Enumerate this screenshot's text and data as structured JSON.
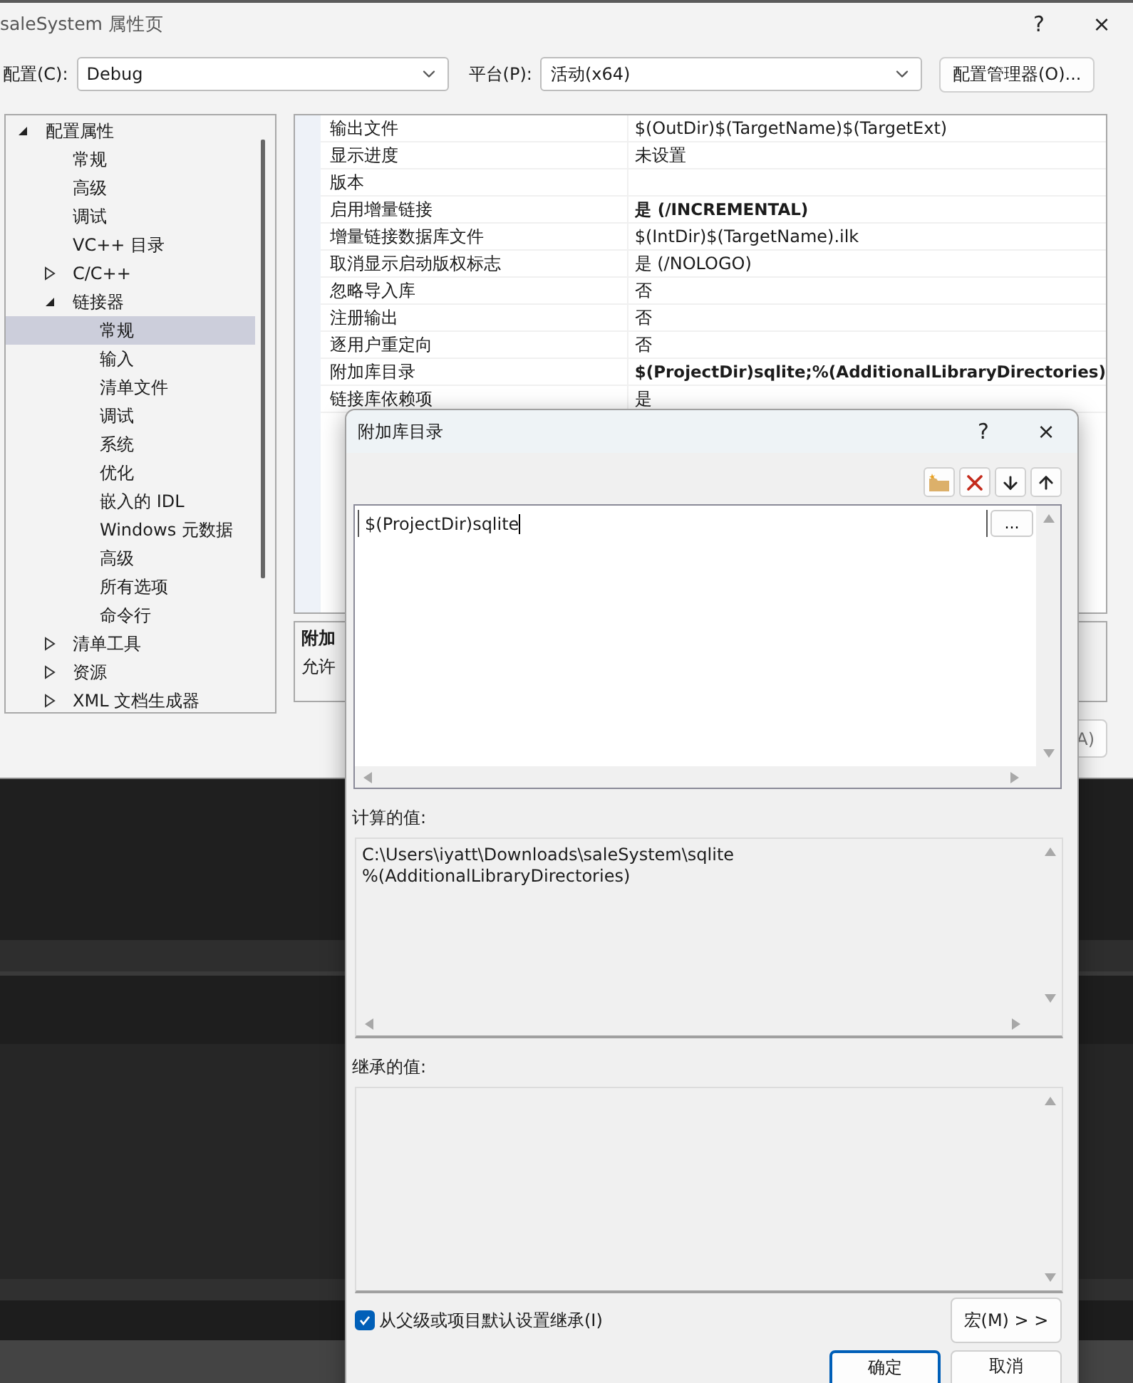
{
  "window": {
    "title": "saleSystem 属性页",
    "help": "?",
    "close": "×"
  },
  "config": {
    "label": "配置(C):",
    "value": "Debug"
  },
  "platform": {
    "label": "平台(P):",
    "value": "活动(x64)"
  },
  "config_manager_button": "配置管理器(O)...",
  "tree": [
    {
      "label": "配置属性",
      "expanded": true,
      "selected": false,
      "children": [
        {
          "label": "常规",
          "selected": false
        },
        {
          "label": "高级",
          "selected": false
        },
        {
          "label": "调试",
          "selected": false
        },
        {
          "label": "VC++ 目录",
          "selected": false
        },
        {
          "label": "C/C++",
          "expanded": false,
          "selected": false
        },
        {
          "label": "链接器",
          "expanded": true,
          "selected": false,
          "children": [
            {
              "label": "常规",
              "selected": true
            },
            {
              "label": "输入",
              "selected": false
            },
            {
              "label": "清单文件",
              "selected": false
            },
            {
              "label": "调试",
              "selected": false
            },
            {
              "label": "系统",
              "selected": false
            },
            {
              "label": "优化",
              "selected": false
            },
            {
              "label": "嵌入的 IDL",
              "selected": false
            },
            {
              "label": "Windows 元数据",
              "selected": false
            },
            {
              "label": "高级",
              "selected": false
            },
            {
              "label": "所有选项",
              "selected": false
            },
            {
              "label": "命令行",
              "selected": false
            }
          ]
        },
        {
          "label": "清单工具",
          "expanded": false,
          "selected": false
        },
        {
          "label": "资源",
          "expanded": false,
          "selected": false
        },
        {
          "label": "XML 文档生成器",
          "expanded": false,
          "selected": false
        }
      ]
    }
  ],
  "properties": [
    {
      "name": "输出文件",
      "value": "$(OutDir)$(TargetName)$(TargetExt)",
      "bold": false
    },
    {
      "name": "显示进度",
      "value": "未设置",
      "bold": false
    },
    {
      "name": "版本"
    },
    {
      "name": "启用增量链接",
      "value": "是 (/INCREMENTAL)",
      "bold": true
    },
    {
      "name": "增量链接数据库文件",
      "value": "$(IntDir)$(TargetName).ilk",
      "bold": false
    },
    {
      "name": "取消显示启动版权标志",
      "value": "是 (/NOLOGO)",
      "bold": false
    },
    {
      "name": "忽略导入库",
      "value": "否",
      "bold": false
    },
    {
      "name": "注册输出",
      "value": "否",
      "bold": false
    },
    {
      "name": "逐用户重定向",
      "value": "否",
      "bold": false
    },
    {
      "name": "附加库目录",
      "value": "$(ProjectDir)sqlite;%(AdditionalLibraryDirectories)",
      "bold": true
    },
    {
      "name": "链接库依赖项",
      "value": "是",
      "bold": false
    }
  ],
  "description": {
    "title": "附加",
    "text": "允许"
  },
  "apply_button": "A)",
  "dialog": {
    "title": "附加库目录",
    "help": "?",
    "close": "×",
    "entries": [
      "$(ProjectDir)sqlite"
    ],
    "browse_button": "...",
    "computed_label": "计算的值:",
    "computed_lines": [
      "C:\\Users\\iyatt\\Downloads\\saleSystem\\sqlite",
      "%(AdditionalLibraryDirectories)"
    ],
    "inherited_label": "继承的值:",
    "inherit_checkbox": {
      "label": "从父级或项目默认设置继承(I)",
      "checked": true
    },
    "macro_button": "宏(M) > >",
    "ok_button": "确定",
    "cancel_button": "取消"
  }
}
